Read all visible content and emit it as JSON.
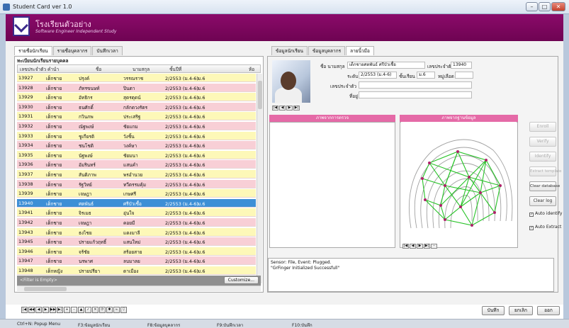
{
  "window": {
    "title": "Student Card ver 1.0",
    "min": "–",
    "max": "□",
    "close": "✕"
  },
  "banner": {
    "school": "โรงเรียนตัวอย่าง",
    "subtitle": "Software Engineer Independent Study"
  },
  "left_tabs": [
    "รายชื่อนักเรียน",
    "รายชื่อบุคลากร",
    "บันทึกเวลา"
  ],
  "student_list": {
    "title": "ทะเบียนนักเรียนรายบุคคล",
    "columns": [
      "เลขประจำตัว",
      "คำนำ",
      "ชื่อ",
      "นามสกุล",
      "ชั้นปีที่",
      "ห้อ"
    ],
    "rows": [
      {
        "id": "13927",
        "prefix": "เด็กชาย",
        "first": "ปรุงค์",
        "last": "วรรณราช",
        "cls": "2/2553 (ม.4-6)",
        "room": "ม.6",
        "tone": "yellow"
      },
      {
        "id": "13928",
        "prefix": "เด็กชาย",
        "first": "ภัทรขนษท์",
        "last": "ปินตา",
        "cls": "2/2553 (ม.4-6)",
        "room": "ม.6",
        "tone": "pink"
      },
      {
        "id": "13929",
        "prefix": "เด็กชาย",
        "first": "อัทธิกร",
        "last": "สุดรตุดน์",
        "cls": "2/2553 (ม.4-6)",
        "room": "ม.6",
        "tone": "yellow"
      },
      {
        "id": "13930",
        "prefix": "เด็กชาย",
        "first": "ธนศักดิ์",
        "last": "กลักดวงรัตร",
        "cls": "2/2553 (ม.4-6)",
        "room": "ม.6",
        "tone": "pink"
      },
      {
        "id": "13931",
        "prefix": "เด็กชาย",
        "first": "กวินภพ",
        "last": "ประเสริฐ",
        "cls": "2/2553 (ม.4-6)",
        "room": "ม.6",
        "tone": "yellow"
      },
      {
        "id": "13932",
        "prefix": "เด็กชาย",
        "first": "ณัฐพงษ์",
        "last": "ชัยแกม",
        "cls": "2/2553 (ม.4-6)",
        "room": "ม.6",
        "tone": "pink"
      },
      {
        "id": "13933",
        "prefix": "เด็กชาย",
        "first": "ชูเกียรติ",
        "last": "วังชิ้น",
        "cls": "2/2553 (ม.4-6)",
        "room": "ม.6",
        "tone": "yellow"
      },
      {
        "id": "13934",
        "prefix": "เด็กชาย",
        "first": "ชนโชติ",
        "last": "วงค์ษา",
        "cls": "2/2553 (ม.4-6)",
        "room": "ม.6",
        "tone": "pink"
      },
      {
        "id": "13935",
        "prefix": "เด็กชาย",
        "first": "นัฐพงษ์",
        "last": "ชัยมนา",
        "cls": "2/2553 (ม.4-6)",
        "room": "ม.6",
        "tone": "yellow"
      },
      {
        "id": "13936",
        "prefix": "เด็กชาย",
        "first": "อัมรินทร์",
        "last": "แสนคำ",
        "cls": "2/2553 (ม.4-6)",
        "room": "ม.6",
        "tone": "pink"
      },
      {
        "id": "13937",
        "prefix": "เด็กชาย",
        "first": "สันติภาพ",
        "last": "พรอำนวย",
        "cls": "2/2553 (ม.4-6)",
        "room": "ม.6",
        "tone": "yellow"
      },
      {
        "id": "13938",
        "prefix": "เด็กชาย",
        "first": "รัฐวิทย์",
        "last": "ทวีตรรมคุ้ม",
        "cls": "2/2553 (ม.4-6)",
        "room": "ม.6",
        "tone": "pink"
      },
      {
        "id": "13939",
        "prefix": "เด็กชาย",
        "first": "เจษฎา",
        "last": "เกษศรี",
        "cls": "2/2553 (ม.4-6)",
        "room": "ม.6",
        "tone": "yellow"
      },
      {
        "id": "13940",
        "prefix": "เด็กชาย",
        "first": "ศตพันธ์",
        "last": "ศรีบัวเชื้อ",
        "cls": "2/2553 (ม.4-6)",
        "room": "ม.6",
        "tone": "sel"
      },
      {
        "id": "13941",
        "prefix": "เด็กชาย",
        "first": "จิรเมธ",
        "last": "อุ่นใจ",
        "cls": "2/2553 (ม.4-6)",
        "room": "ม.6",
        "tone": "yellow"
      },
      {
        "id": "13942",
        "prefix": "เด็กชาย",
        "first": "เจษฎา",
        "last": "คอยมี",
        "cls": "2/2553 (ม.4-6)",
        "room": "ม.6",
        "tone": "pink"
      },
      {
        "id": "13943",
        "prefix": "เด็กชาย",
        "first": "ธงไชย",
        "last": "แดงมาลี",
        "cls": "2/2553 (ม.4-6)",
        "room": "ม.6",
        "tone": "yellow"
      },
      {
        "id": "13945",
        "prefix": "เด็กชาย",
        "first": "ปรายแก้วฤทธิ์",
        "last": "แสนใหม่",
        "cls": "2/2553 (ม.4-6)",
        "room": "ม.6",
        "tone": "pink"
      },
      {
        "id": "13946",
        "prefix": "เด็กชาย",
        "first": "จร้ชัย",
        "last": "สร้อยสาย",
        "cls": "2/2553 (ม.4-6)",
        "room": "ม.6",
        "tone": "yellow"
      },
      {
        "id": "13947",
        "prefix": "เด็กชาย",
        "first": "นรพาศ",
        "last": "ลบมาลย",
        "cls": "2/2553 (ม.4-6)",
        "room": "ม.6",
        "tone": "pink"
      },
      {
        "id": "13948",
        "prefix": "เด็กหญิง",
        "first": "ปรายปรียา",
        "last": "ดาเมือง",
        "cls": "2/2553 (ม.4-6)",
        "room": "ม.6",
        "tone": "yellow"
      }
    ],
    "filter_text": "<Filter is Empty>",
    "customize_label": "Customize..."
  },
  "right_tabs": [
    "ข้อมูลนักเรียน",
    "ข้อมูลบุคลากร",
    "ลายนิ้วมือ"
  ],
  "record": {
    "name_label": "ชื่อ นามสกุล",
    "name_value": "เด็กชายศตพันธ์ ศรีบัวเชื้อ",
    "id_label": "เลขประจำตัว",
    "id_value": "13940",
    "level_label": "ระดับ",
    "level_value": "2/2553 (ม.4-6)",
    "year_label": "ชั้นเรียน",
    "year_value": "ม.6",
    "room_label": "หมู่เลือด",
    "room_value": "",
    "blood_label": "เลขประจำตัว",
    "addr_label": "ที่อยู่",
    "photo_pager": [
      "|◀",
      "◀",
      "▶",
      "▶|"
    ]
  },
  "fingerprint": {
    "scan_header": "ภาพจากการตรวจ",
    "template_header": "ภาพจากฐานข้อมูล",
    "pager": [
      "|◀",
      "◀",
      "▶",
      "▶|",
      "–"
    ]
  },
  "side_buttons": [
    {
      "label": "Enroll",
      "enabled": false
    },
    {
      "label": "Verify",
      "enabled": false
    },
    {
      "label": "Identify",
      "enabled": false
    },
    {
      "label": "Extract template",
      "enabled": false
    },
    {
      "label": "Clear database",
      "enabled": true
    },
    {
      "label": "Clear log",
      "enabled": true
    }
  ],
  "checks": [
    {
      "label": "Auto identify",
      "checked": true
    },
    {
      "label": "Auto Extract",
      "checked": true
    }
  ],
  "log": {
    "line1": "Sensor: File, Event: Plugged.",
    "line2": "\"GrFinger Initialized Successfull\""
  },
  "nav_bar": [
    "|◀",
    "◀◀",
    "◀",
    "▶",
    "▶▶",
    "▶|",
    "+",
    "–",
    "▲",
    "✓",
    "✕",
    "⟳",
    "✱",
    "≈",
    "▽"
  ],
  "actions": {
    "save": "บันทึก",
    "cancel": "ยกเลิก",
    "exit": "ออก"
  },
  "status": {
    "left": "Ctrl+N: Popup Menu",
    "f3": "F3:ข้อมูลนักเรียน",
    "f8": "F8:ข้อมูลบุคลากร",
    "f9": "F9:บันทึกเวลา",
    "f10": "F10:บันทึก"
  },
  "colors": {
    "banner": "#7d0860",
    "row_yellow": "#fdf8b8",
    "row_pink": "#f8cfd6",
    "row_selected": "#3d8fd6",
    "pane_header": "#e56aa7"
  }
}
